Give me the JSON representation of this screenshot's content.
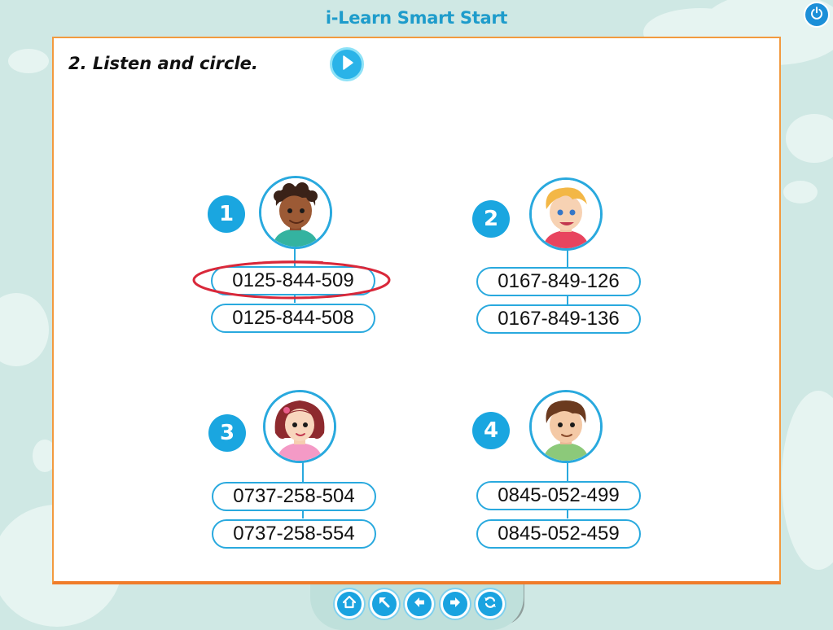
{
  "app": {
    "title": "i-Learn Smart Start"
  },
  "exercise": {
    "instruction": "2. Listen and circle."
  },
  "items": [
    {
      "number": "1",
      "options": [
        "0125-844-509",
        "0125-844-508"
      ],
      "circled": 0
    },
    {
      "number": "2",
      "options": [
        "0167-849-126",
        "0167-849-136"
      ],
      "circled": null
    },
    {
      "number": "3",
      "options": [
        "0737-258-504",
        "0737-258-554"
      ],
      "circled": null
    },
    {
      "number": "4",
      "options": [
        "0845-052-499",
        "0845-052-459"
      ],
      "circled": null
    }
  ],
  "icons": {
    "power": "power-icon",
    "play": "play-icon",
    "nav": [
      "home-icon",
      "back-to-menu-icon",
      "previous-icon",
      "next-icon",
      "refresh-icon"
    ]
  },
  "colors": {
    "accent": "#1aa6e0",
    "panel_border": "#f29a3f",
    "circle_mark": "#d9283a",
    "background": "#cfe8e4"
  }
}
